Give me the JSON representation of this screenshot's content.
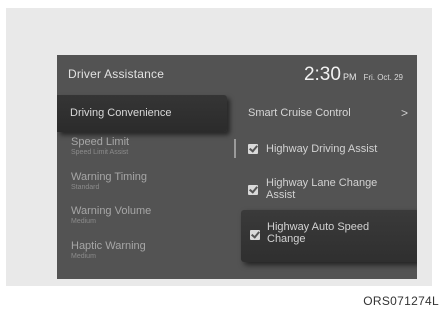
{
  "header": {
    "title": "Driver Assistance",
    "time": "2:30",
    "ampm": "PM",
    "date": "Fri. Oct. 29"
  },
  "left_menu": {
    "selected": "Driving Convenience",
    "items": [
      {
        "label": "Speed Limit",
        "sub": "Speed Limit Assist"
      },
      {
        "label": "Warning Timing",
        "sub": "Standard"
      },
      {
        "label": "Warning Volume",
        "sub": "Medium"
      },
      {
        "label": "Haptic Warning",
        "sub": "Medium"
      }
    ]
  },
  "right_list": {
    "submenu": {
      "label": "Smart Cruise Control",
      "chevron": ">"
    },
    "options": [
      {
        "label": "Highway Driving Assist",
        "checked": true
      },
      {
        "label_line1": "Highway Lane Change",
        "label_line2": "Assist",
        "checked": true
      },
      {
        "label_line1": "Highway Auto Speed",
        "label_line2": "Change",
        "checked": true,
        "selected": true
      }
    ]
  },
  "caption": "ORS071274L"
}
